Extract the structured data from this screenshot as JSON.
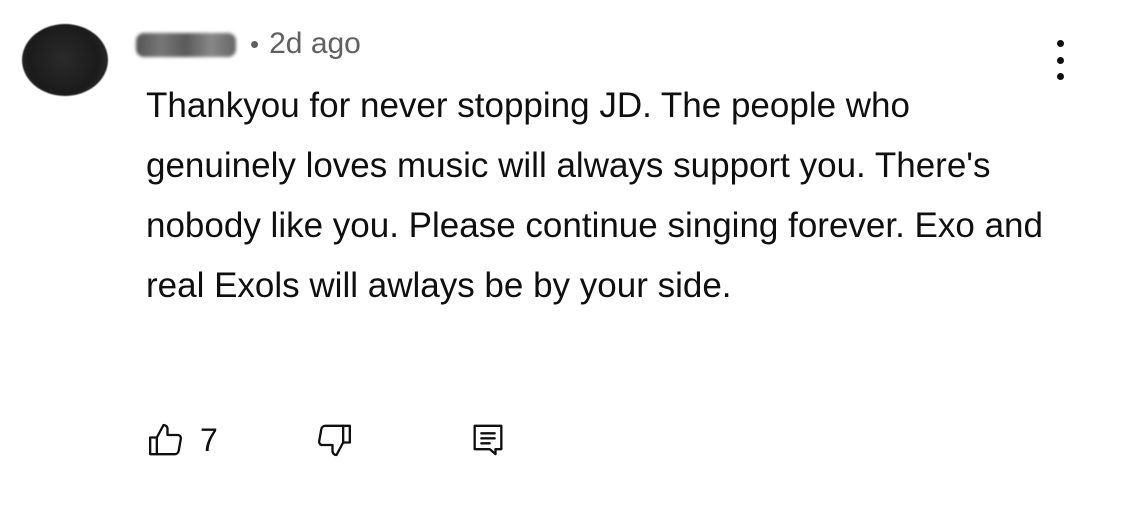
{
  "comment": {
    "author": "user",
    "separator": "•",
    "time": "2d ago",
    "text": "Thankyou for never stopping JD. The people who genuinely loves music will always support you. There's nobody like you. Please continue singing forever. Exo and real Exols will awlays be by your side.",
    "like_count": "7"
  },
  "icons": {
    "menu": "more-vertical-icon",
    "like": "thumbs-up-icon",
    "dislike": "thumbs-down-icon",
    "reply": "comment-reply-icon"
  }
}
